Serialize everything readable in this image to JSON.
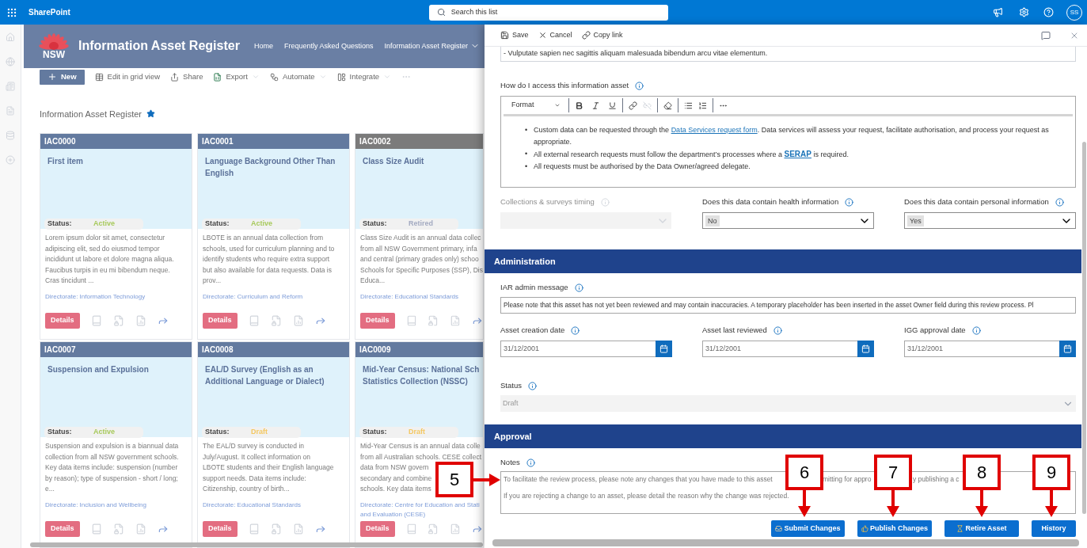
{
  "app": {
    "name": "SharePoint"
  },
  "search": {
    "placeholder": "Search this list"
  },
  "user": {
    "initials": "SS"
  },
  "site": {
    "logo_text": "NSW",
    "title": "Information Asset Register",
    "nav": [
      {
        "label": "Home",
        "has_menu": false
      },
      {
        "label": "Frequently Asked Questions",
        "has_menu": false
      },
      {
        "label": "Information Asset Register",
        "has_menu": true
      }
    ]
  },
  "commands": [
    {
      "label": "New",
      "kind": "new",
      "has_menu": false
    },
    {
      "label": "Edit in grid view",
      "kind": "grid",
      "has_menu": false
    },
    {
      "label": "Share",
      "kind": "share",
      "has_menu": false
    },
    {
      "label": "Export",
      "kind": "export",
      "has_menu": true
    },
    {
      "label": "Automate",
      "kind": "automate",
      "has_menu": true
    },
    {
      "label": "Integrate",
      "kind": "integrate",
      "has_menu": true
    }
  ],
  "list": {
    "title": "Information Asset Register",
    "favorite": true
  },
  "cards": [
    {
      "id": "IAC0000",
      "selected": false,
      "title_lines": [
        "First item"
      ],
      "status_label": "Status:",
      "status": {
        "text": "Active",
        "color": "#a7c95b"
      },
      "description_lines": [
        "Lorem ipsum dolor sit amet, consectetur",
        "adipiscing elit, sed do eiusmod tempor",
        "incididunt ut labore et dolore magna aliqua.",
        "Faucibus turpis in eu mi bibendum neque.",
        "Cras tincidunt ..."
      ],
      "directorate_lines": [
        "Directorate: Information Technology"
      ],
      "button": "Details"
    },
    {
      "id": "IAC0001",
      "selected": false,
      "title_lines": [
        "Language Background Other Than",
        "English"
      ],
      "status_label": "Status:",
      "status": {
        "text": "Active",
        "color": "#a7c95b"
      },
      "description_lines": [
        "LBOTE is an annual data collection from",
        "schools, used for curriculum planning and to",
        "identify students who require extra support",
        "but also available for data requests. Data is",
        "prov..."
      ],
      "directorate_lines": [
        "Directorate: Curriculum and Reform"
      ],
      "button": "Details"
    },
    {
      "id": "IAC0002",
      "selected": true,
      "title_lines": [
        "Class Size Audit"
      ],
      "status_label": "Status:",
      "status": {
        "text": "Retired",
        "color": "#a3aac1"
      },
      "description_lines": [
        "Class Size Audit is an annual data collec",
        "from all NSW Government primary, infa",
        "and central (primary grades only) schoo",
        "Schools for Specific Purposes (SSP), Dis",
        "Educa..."
      ],
      "directorate_lines": [
        "Directorate: Educational Standards"
      ],
      "button": "Details"
    },
    {
      "id": "IAC0007",
      "selected": false,
      "title_lines": [
        "Suspension and Expulsion"
      ],
      "status_label": "Status:",
      "status": {
        "text": "Active",
        "color": "#a7c95b"
      },
      "description_lines": [
        "Suspension and expulsion is a biannual data",
        "collection from all NSW government schools.",
        "Key data items include: suspension (number",
        "by reason); type of suspension - short / long;",
        "e..."
      ],
      "directorate_lines": [
        "Directorate: Inclusion and Wellbeing"
      ],
      "button": "Details"
    },
    {
      "id": "IAC0008",
      "selected": false,
      "title_lines": [
        "EAL/D Survey (English as an",
        "Additional Language or Dialect)"
      ],
      "status_label": "Status:",
      "status": {
        "text": "Draft",
        "color": "#f4c761"
      },
      "description_lines": [
        "The EAL/D survey is conducted in",
        "July/August.  It  collect information on",
        "LBOTE students and their English language",
        "support needs. Data items include:",
        "Citizenship, country of birth..."
      ],
      "directorate_lines": [
        "Directorate: Educational Standards"
      ],
      "button": "Details"
    },
    {
      "id": "IAC0009",
      "selected": false,
      "title_lines": [
        "Mid-Year Census: National Sch",
        "Statistics Collection (NSSC)"
      ],
      "status_label": "Status:",
      "status": {
        "text": "Draft",
        "color": "#f4c761"
      },
      "description_lines": [
        "Mid-Year Census is an annual data colle",
        "from all Australian schools. CESE collect",
        "data from NSW govern",
        "secondary and combine",
        "schools. Key data items"
      ],
      "directorate_lines": [
        "Directorate: Centre for Education and Stati",
        "and Evaluation (CESE)"
      ],
      "button": "Details"
    }
  ],
  "panel": {
    "toolbar": [
      {
        "label": "Save",
        "kind": "save"
      },
      {
        "label": "Cancel",
        "kind": "cancel"
      },
      {
        "label": "Copy link",
        "kind": "link"
      }
    ],
    "previous_field_text": "- Vulputate sapien nec sagittis aliquam malesuada bibendum arcu vitae elementum.",
    "access": {
      "label": "How do I access this information asset",
      "format_label": "Format",
      "bullets": [
        {
          "marker": "•",
          "segments": [
            {
              "text": "Custom data can be requested through the ",
              "kind": "text"
            },
            {
              "text": "Data Services request form",
              "kind": "link"
            },
            {
              "text": ".  Data services will assess your request, facilitate authorisation, and process your request as appropriate.",
              "kind": "text"
            }
          ]
        },
        {
          "marker": "•",
          "segments": [
            {
              "text": "All external research requests must follow the department’s processes where a ",
              "kind": "text"
            },
            {
              "text": "SERAP",
              "kind": "strong_link"
            },
            {
              "text": " is required.",
              "kind": "text"
            }
          ]
        },
        {
          "marker": "•",
          "segments": [
            {
              "text": "All requests must be authorised by the Data Owner/agreed delegate.",
              "kind": "text"
            }
          ]
        }
      ]
    },
    "questions": [
      {
        "label": "Collections & surveys timing",
        "disabled": true
      },
      {
        "label": "Does this data contain health information",
        "disabled": false,
        "value": "No"
      },
      {
        "label": "Does this data contain personal information",
        "disabled": false,
        "value": "Yes"
      }
    ],
    "administration": {
      "title": "Administration",
      "message_label": "IAR admin message",
      "message": "Please note that this asset has not yet been reviewed and may contain inaccuracies. A temporary placeholder has been inserted in the asset Owner field during this review process. Pl",
      "dates": [
        {
          "label": "Asset creation date",
          "value": "31/12/2001"
        },
        {
          "label": "Asset last reviewed",
          "value": "31/12/2001"
        },
        {
          "label": "IGG approval date",
          "value": "31/12/2001"
        }
      ],
      "status": {
        "label": "Status",
        "value": "Draft",
        "disabled": true
      }
    },
    "approval": {
      "title": "Approval",
      "notes_label": "Notes",
      "notes_line_1_fragments": [
        "To facilitate the review process, please note any changes that you have made to this asset",
        "mitting for appro",
        "y publishing a c"
      ],
      "notes_line_2": "If you are rejecting a change to an asset, please detail the reason why the change was rejected.",
      "buttons": [
        {
          "label": "Submit Changes",
          "kind": "submit"
        },
        {
          "label": "Publish Changes",
          "kind": "publish"
        },
        {
          "label": "Retire Asset",
          "kind": "retire"
        },
        {
          "label": "History",
          "kind": "history"
        }
      ]
    }
  },
  "callouts": [
    {
      "number": "5"
    },
    {
      "number": "6"
    },
    {
      "number": "7"
    },
    {
      "number": "8"
    },
    {
      "number": "9"
    }
  ]
}
